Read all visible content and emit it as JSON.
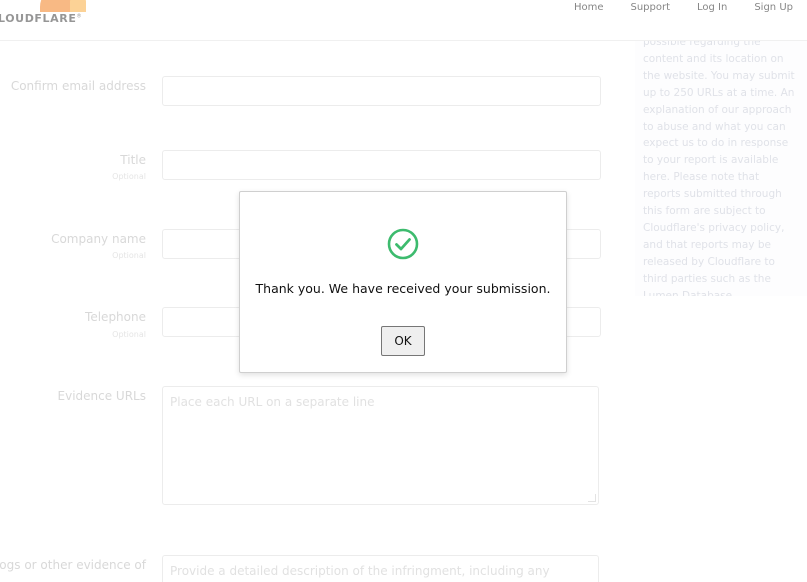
{
  "header": {
    "logo_text": "LOUDFLARE",
    "logo_mark": "®",
    "nav": [
      {
        "label": "Home"
      },
      {
        "label": "Support"
      },
      {
        "label": "Log In"
      },
      {
        "label": "Sign Up"
      }
    ]
  },
  "form": {
    "confirm_email": {
      "label": "Confirm email address"
    },
    "title": {
      "label": "Title",
      "optional": "Optional"
    },
    "company": {
      "label": "Company name",
      "optional": "Optional"
    },
    "telephone": {
      "label": "Telephone",
      "optional": "Optional"
    },
    "evidence_urls": {
      "label": "Evidence URLs",
      "placeholder": "Place each URL on a separate line"
    },
    "logs": {
      "label": "Logs or other evidence of",
      "placeholder": "Provide a detailed description of the infringment, including any necessary"
    }
  },
  "sidebar": {
    "text": "possible regarding the content and its location on the website. You may submit up to 250 URLs at a time. An explanation of our approach to abuse and what you can expect us to do in response to your report is available here. Please note that reports submitted through this form are subject to Cloudflare's privacy policy, and that reports may be released by Cloudflare to third parties such as the Lumen Database."
  },
  "dialog": {
    "icon": "check-circle-icon",
    "message": "Thank you. We have received your submission.",
    "ok_label": "OK",
    "accent_color": "#3dbb6e"
  }
}
